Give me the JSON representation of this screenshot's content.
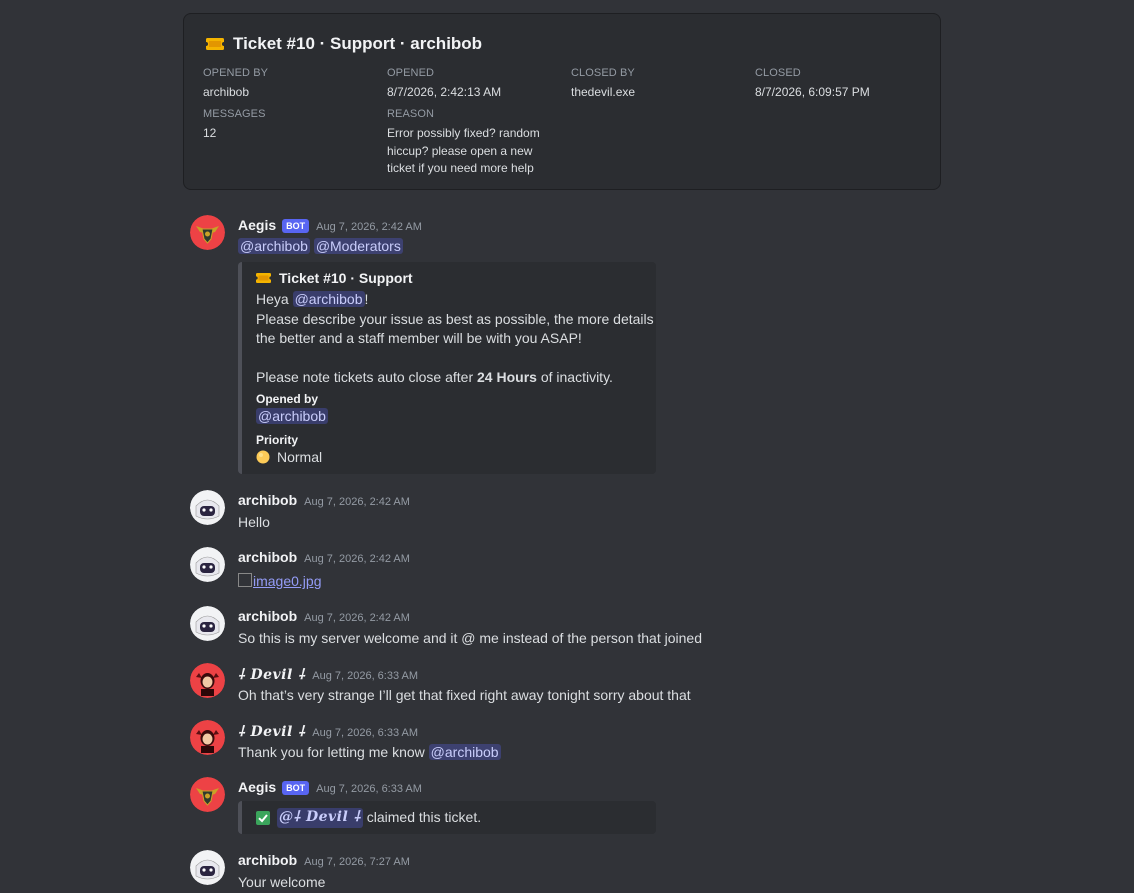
{
  "ticket": {
    "title": "Ticket #10 · Support · archibob",
    "opened_by_label": "OPENED BY",
    "opened_by": "archibob",
    "opened_label": "OPENED",
    "opened": "8/7/2026, 2:42:13 AM",
    "closed_by_label": "CLOSED BY",
    "closed_by": "thedevil.exe",
    "closed_label": "CLOSED",
    "closed": "8/7/2026, 6:09:57 PM",
    "messages_label": "MESSAGES",
    "messages": "12",
    "reason_label": "REASON",
    "reason_lines": [
      "Error possibly fixed? random",
      "hiccup? please open a new",
      "ticket if you need more help"
    ]
  },
  "messages": [
    {
      "author": "Aegis",
      "bot_tag": "BOT",
      "timestamp": "Aug 7, 2026, 2:42 AM",
      "mentions": [
        "@archibob",
        "@Moderators"
      ],
      "embed": {
        "title": "Ticket #10 · Support",
        "greeting": "Heya",
        "greeting_mention": "@archibob",
        "greeting_end": "!",
        "line1": "Please describe your issue as best as possible, the more details",
        "line2": "the better and a staff member will be with you ASAP!",
        "line3_pre": "Please note tickets auto close after",
        "line3_bold": "24 Hours",
        "line3_post": "of inactivity.",
        "field1_name": "Opened by",
        "field1_value": "@archibob",
        "field2_name": "Priority",
        "field2_value": "Normal"
      }
    },
    {
      "author": "archibob",
      "timestamp": "Aug 7, 2026, 2:42 AM",
      "text": "Hello"
    },
    {
      "author": "archibob",
      "timestamp": "Aug 7, 2026, 2:42 AM",
      "link": "image0.jpg"
    },
    {
      "author": "archibob",
      "timestamp": "Aug 7, 2026, 2:42 AM",
      "text": "So this is my server welcome and it @ me instead of the person that joined"
    },
    {
      "author": "⸸ 𝓓𝓮𝓿𝓲𝓵 ⸸",
      "author_plain": "Devil",
      "timestamp": "Aug 7, 2026, 6:33 AM",
      "text": "Oh that’s very strange I’ll get that fixed right away tonight sorry about that"
    },
    {
      "author": "Devil",
      "timestamp": "Aug 7, 2026, 6:33 AM",
      "text": "Thank you for letting me know",
      "mention": "@archibob"
    },
    {
      "author": "Aegis",
      "bot_tag": "BOT",
      "timestamp": "Aug 7, 2026, 6:33 AM",
      "claim_mention": "@Devil",
      "claim_text": "claimed this ticket."
    },
    {
      "author": "archibob",
      "timestamp": "Aug 7, 2026, 7:27 AM",
      "text": "Your welcome"
    }
  ],
  "devil_display": "Devil",
  "icons": {
    "ticket": "ticket-icon",
    "priority": "yellow-circle-icon",
    "claim": "check-mark-button-icon"
  },
  "colors": {
    "background": "#313338",
    "card": "#2b2d31",
    "bot_tag": "#5865f2",
    "mention_bg": "#3c4270",
    "check_green": "#3ba55c",
    "avatar_red": "#ed4245"
  }
}
